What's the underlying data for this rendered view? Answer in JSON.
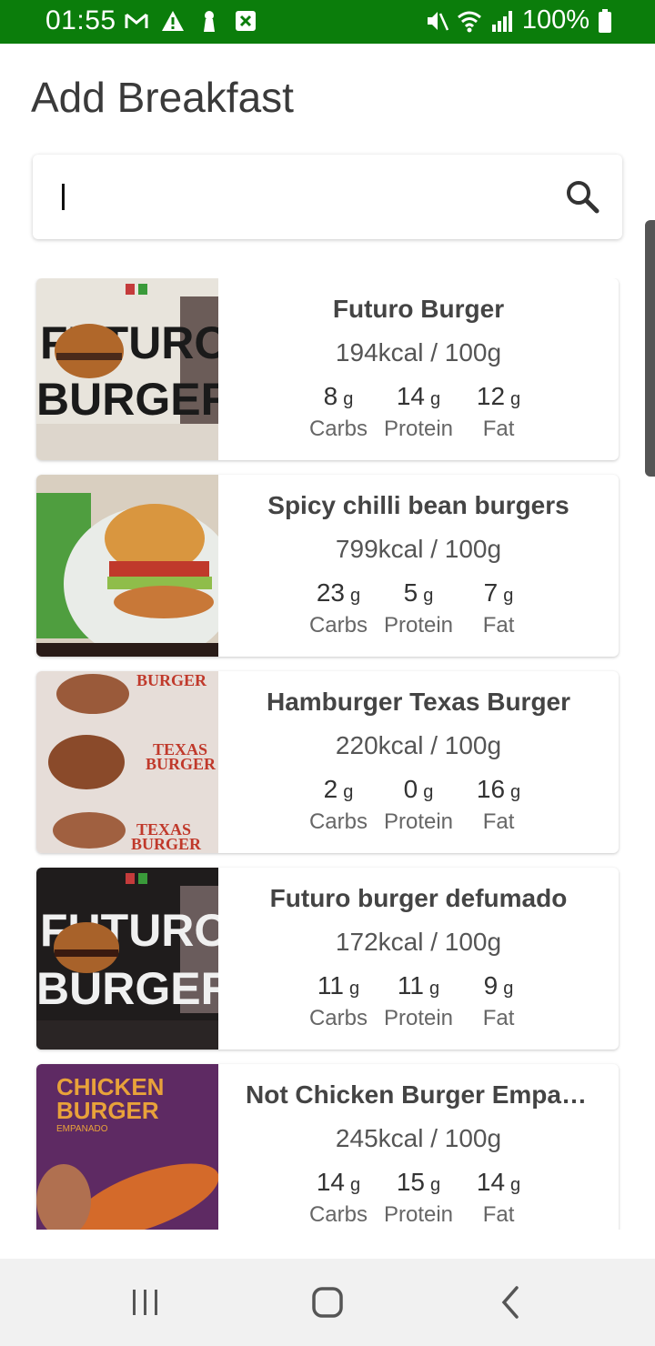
{
  "status": {
    "time": "01:55",
    "battery": "100%",
    "left_icons": [
      "gmail-icon",
      "warning-icon",
      "keyhole-icon",
      "excel-icon"
    ],
    "right_icons": [
      "mute-icon",
      "wifi-icon",
      "signal-icon",
      "battery-icon"
    ]
  },
  "page": {
    "title": "Add Breakfast"
  },
  "search": {
    "value": "",
    "placeholder": ""
  },
  "foods": [
    {
      "name": "Futuro Burger",
      "kcal": "194kcal / 100g",
      "carbs": "8",
      "protein": "14",
      "fat": "12"
    },
    {
      "name": "Spicy chilli bean burgers",
      "kcal": "799kcal / 100g",
      "carbs": "23",
      "protein": "5",
      "fat": "7"
    },
    {
      "name": "Hamburger Texas Burger",
      "kcal": "220kcal / 100g",
      "carbs": "2",
      "protein": "0",
      "fat": "16"
    },
    {
      "name": "Futuro burger defumado",
      "kcal": "172kcal / 100g",
      "carbs": "11",
      "protein": "11",
      "fat": "9"
    },
    {
      "name": "Not Chicken Burger Empana...",
      "kcal": "245kcal / 100g",
      "carbs": "14",
      "protein": "15",
      "fat": "14"
    }
  ],
  "labels": {
    "unit": "g",
    "carbs": "Carbs",
    "protein": "Protein",
    "fat": "Fat"
  },
  "thumb_text": {
    "futuro": [
      "FUTURO",
      "BURGER"
    ],
    "texas": [
      "BURGER",
      "TEXAS",
      "BURGER",
      "TEXAS",
      "BURGER"
    ],
    "chicken": [
      "CHICKEN",
      "BURGER",
      "EMPANADO"
    ]
  },
  "colors": {
    "status_bar": "#0b7d0b",
    "nav_bar": "#f1f1f1"
  }
}
